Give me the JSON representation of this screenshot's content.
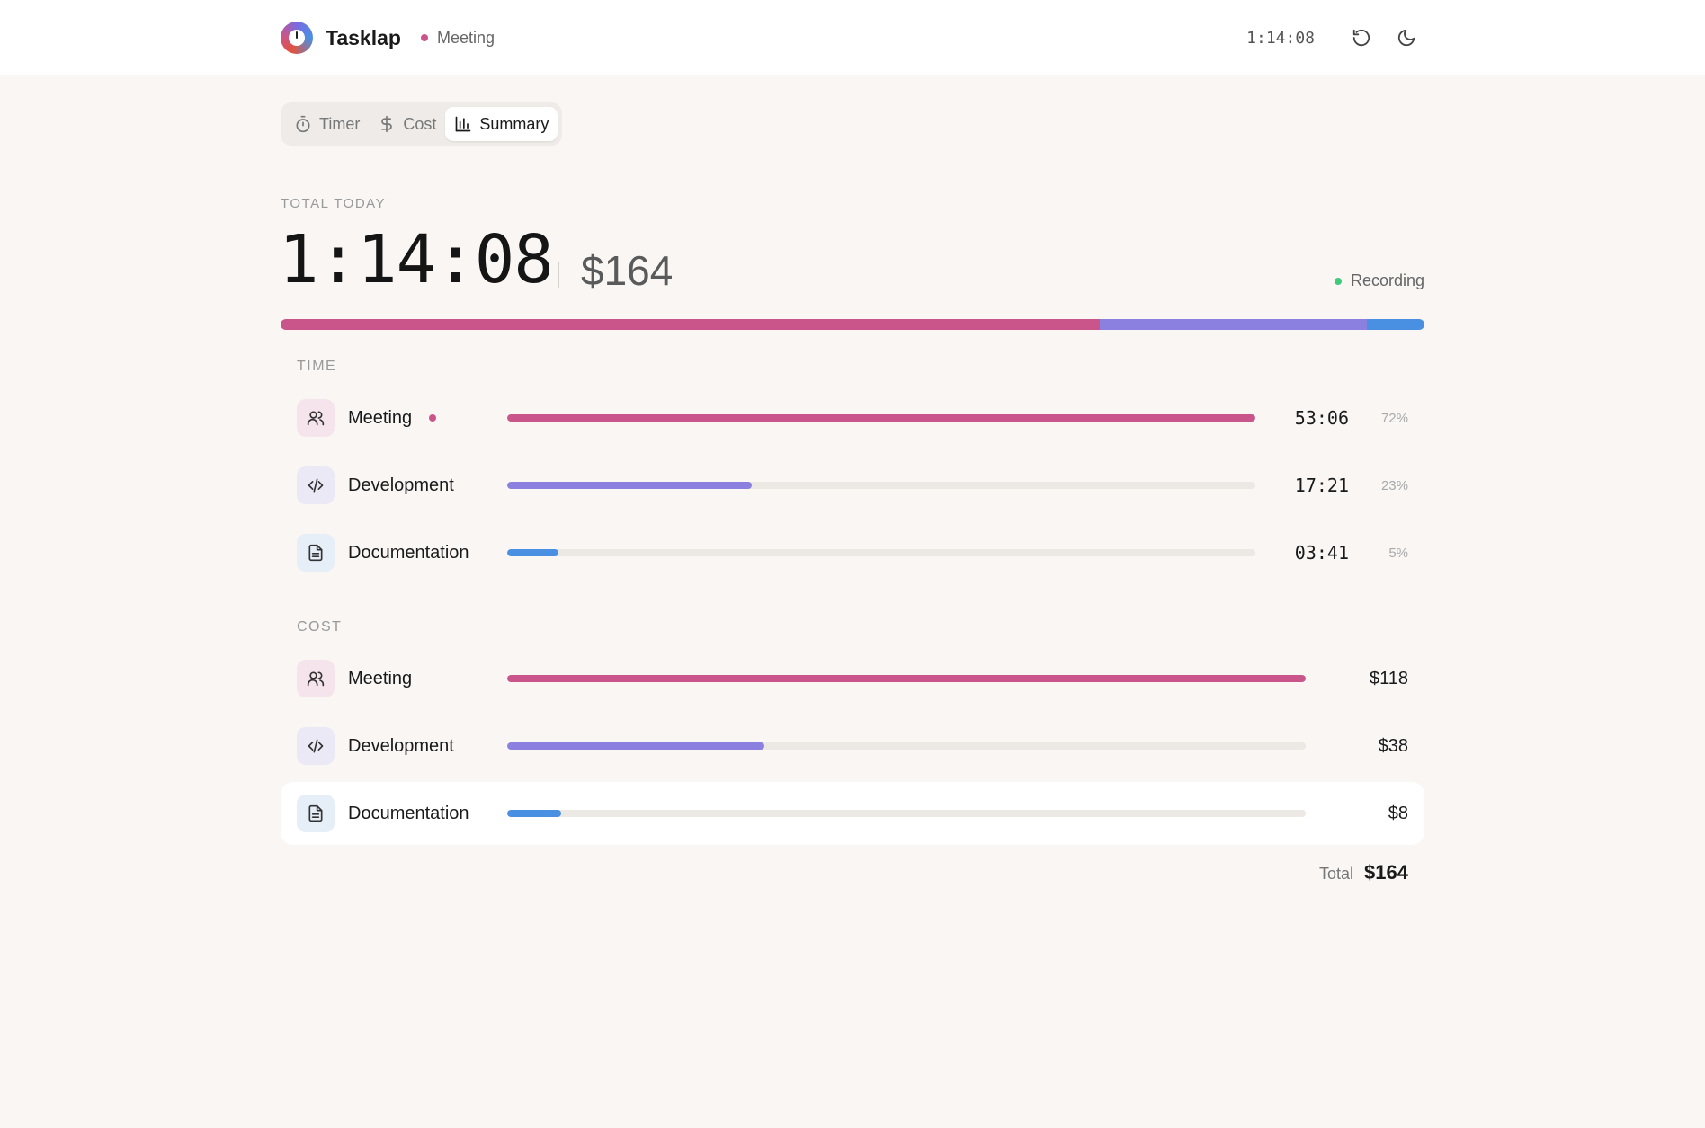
{
  "header": {
    "app_title": "Tasklap",
    "current_task": "Meeting",
    "clock": "1:14:08"
  },
  "tabs": [
    {
      "label": "Timer",
      "icon": "stopwatch-icon",
      "active": false
    },
    {
      "label": "Cost",
      "icon": "dollar-icon",
      "active": false
    },
    {
      "label": "Summary",
      "icon": "bar-chart-icon",
      "active": true
    }
  ],
  "summary": {
    "total_label": "TOTAL TODAY",
    "total_time": "1:14:08",
    "total_cost": "$164",
    "status": "Recording"
  },
  "colors": {
    "meeting": "#c9558a",
    "development": "#8b80e0",
    "documentation": "#4a90e2",
    "recording": "#3ecb7a"
  },
  "stacked_share": [
    {
      "task": "Meeting",
      "fraction": 0.716
    },
    {
      "task": "Development",
      "fraction": 0.234
    },
    {
      "task": "Documentation",
      "fraction": 0.05
    }
  ],
  "time_section": {
    "label": "TIME",
    "rows": [
      {
        "name": "Meeting",
        "icon": "people-icon",
        "value": "53:06",
        "pct": "72%",
        "fraction": 1.0,
        "active": true
      },
      {
        "name": "Development",
        "icon": "code-icon",
        "value": "17:21",
        "pct": "23%",
        "fraction": 0.327,
        "active": false
      },
      {
        "name": "Documentation",
        "icon": "document-icon",
        "value": "03:41",
        "pct": "5%",
        "fraction": 0.069,
        "active": false
      }
    ]
  },
  "cost_section": {
    "label": "COST",
    "rows": [
      {
        "name": "Meeting",
        "icon": "people-icon",
        "value": "$118",
        "fraction": 1.0
      },
      {
        "name": "Development",
        "icon": "code-icon",
        "value": "$38",
        "fraction": 0.322
      },
      {
        "name": "Documentation",
        "icon": "document-icon",
        "value": "$8",
        "fraction": 0.068
      }
    ],
    "total_label": "Total",
    "total_value": "$164"
  }
}
